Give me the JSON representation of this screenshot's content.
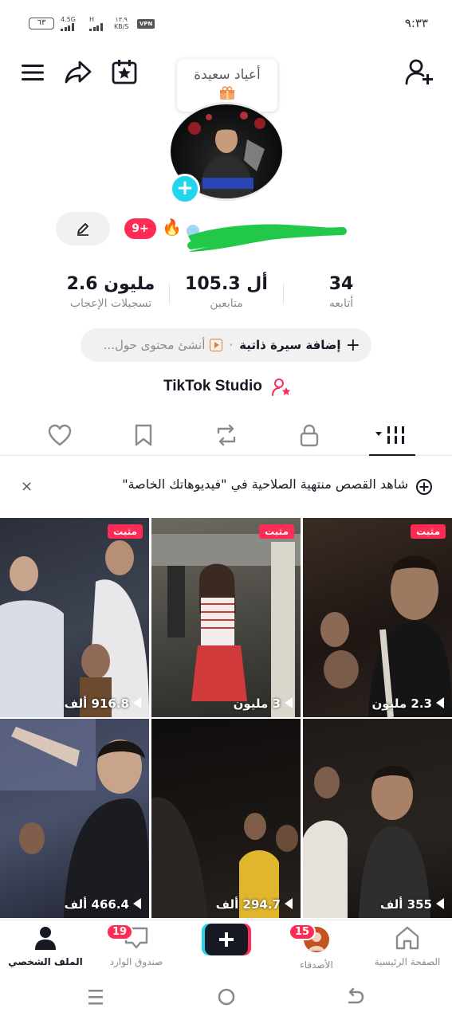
{
  "status_bar": {
    "time": "٩:٣٣",
    "battery": "٦٣",
    "network_1": "4.5G",
    "network_2": "H",
    "speed_value": "١٣.٩",
    "speed_unit": "KB/S",
    "vpn": "VPN"
  },
  "top_bar": {
    "balloon_text": "أعياد سعيدة",
    "icons": [
      "menu-icon",
      "share-icon",
      "calendar-star-icon",
      "add-friend-icon"
    ]
  },
  "profile": {
    "pending_badge": "9+",
    "flame": "🔥",
    "stats": [
      {
        "value": "34",
        "label": "أتابعه"
      },
      {
        "value": "105.3 أل",
        "label": "متابعين"
      },
      {
        "value": "2.6 مليون",
        "label": "تسجيلات الإعجاب"
      }
    ],
    "bio_add": "إضافة سيرة ذاتية",
    "bio_hint": "أنشئ محتوى حول...",
    "studio": "TikTok Studio"
  },
  "tabs": [
    "videos-tab",
    "private-tab",
    "reposts-tab",
    "favorites-tab",
    "liked-tab"
  ],
  "notice": {
    "text": "شاهد القصص منتهية الصلاحية في \"فيديوهاتك الخاصة\"",
    "close": "×"
  },
  "videos": [
    {
      "views": "2.3 مليون",
      "pinned": "مثبت"
    },
    {
      "views": "3 مليون",
      "pinned": "مثبت"
    },
    {
      "views": "916.8 ألف",
      "pinned": "مثبت"
    },
    {
      "views": "355 ألف",
      "pinned": ""
    },
    {
      "views": "294.7 ألف",
      "pinned": ""
    },
    {
      "views": "466.4 ألف",
      "pinned": ""
    }
  ],
  "bottom_nav": {
    "home": "الصفحة الرئيسية",
    "friends": "الأصدقاء",
    "friends_badge": "15",
    "inbox": "صندوق الوارد",
    "inbox_badge": "19",
    "profile": "الملف الشخصي"
  },
  "colors": {
    "accent_red": "#fe2c55",
    "accent_cyan": "#20d5ec",
    "text_primary": "#161823",
    "text_secondary": "#8a8b91"
  }
}
